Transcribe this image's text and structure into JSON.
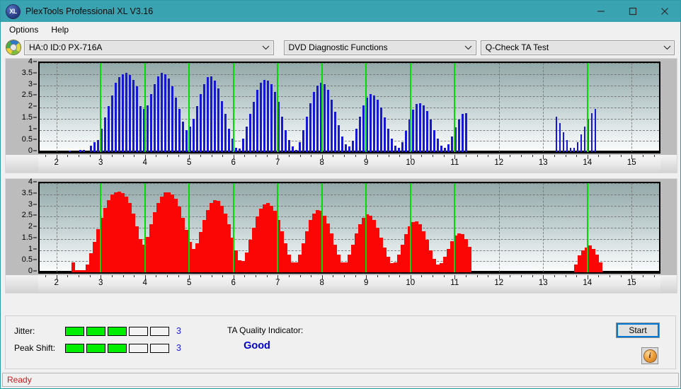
{
  "window": {
    "title": "PlexTools Professional XL V3.16",
    "icon": "xl-disc-icon",
    "minimize_label": "minimize-icon",
    "maximize_label": "maximize-icon",
    "close_label": "close-icon",
    "titlebar_color": "#3aa3b2"
  },
  "menu": {
    "items": [
      {
        "label": "Options"
      },
      {
        "label": "Help"
      }
    ]
  },
  "toolbar": {
    "drive_icon": "optical-disc-icon",
    "drive": {
      "value": "HA:0 ID:0  PX-716A",
      "arrow": "∨"
    },
    "function": {
      "value": "DVD Diagnostic Functions",
      "arrow": "∨"
    },
    "test": {
      "value": "Q-Check TA Test",
      "arrow": "∨"
    }
  },
  "chart_data": [
    {
      "id": "jitter-chart",
      "type": "bar",
      "title": "",
      "color": "#1717d6",
      "xlabel": "",
      "ylabel": "",
      "xlim": [
        1.62,
        15.62
      ],
      "ylim": [
        0,
        4
      ],
      "grid": true,
      "legend": "none",
      "yticks": [
        0,
        0.5,
        1,
        1.5,
        2,
        2.5,
        3,
        3.5,
        4
      ],
      "ytick_labels": [
        "0",
        "0.5",
        "1",
        "1.5",
        "2",
        "2.5",
        "3",
        "3.5",
        "4"
      ],
      "xticks": [
        2,
        3,
        4,
        5,
        6,
        7,
        8,
        9,
        10,
        11,
        12,
        13,
        14,
        15
      ],
      "xtick_labels": [
        "2",
        "3",
        "4",
        "5",
        "6",
        "7",
        "8",
        "9",
        "10",
        "11",
        "12",
        "13",
        "14",
        "15"
      ],
      "markers_x": [
        3,
        4,
        5,
        6,
        7,
        8,
        9,
        10,
        11,
        14
      ],
      "marker_color": "#00dd00",
      "bar_width": 0.042,
      "x": [
        2.3,
        2.38,
        2.46,
        2.54,
        2.62,
        2.7,
        2.78,
        2.86,
        2.94,
        3.02,
        3.1,
        3.18,
        3.26,
        3.34,
        3.42,
        3.5,
        3.58,
        3.66,
        3.74,
        3.82,
        3.9,
        3.98,
        4.06,
        4.14,
        4.22,
        4.3,
        4.38,
        4.46,
        4.54,
        4.62,
        4.7,
        4.78,
        4.86,
        4.94,
        5.02,
        5.1,
        5.18,
        5.26,
        5.34,
        5.42,
        5.5,
        5.58,
        5.66,
        5.74,
        5.82,
        5.9,
        5.98,
        6.06,
        6.14,
        6.22,
        6.3,
        6.38,
        6.46,
        6.54,
        6.62,
        6.7,
        6.78,
        6.86,
        6.94,
        7.02,
        7.1,
        7.18,
        7.26,
        7.34,
        7.42,
        7.5,
        7.58,
        7.66,
        7.74,
        7.82,
        7.9,
        7.98,
        8.06,
        8.14,
        8.22,
        8.3,
        8.38,
        8.46,
        8.54,
        8.62,
        8.7,
        8.78,
        8.86,
        8.94,
        9.02,
        9.1,
        9.18,
        9.26,
        9.34,
        9.42,
        9.5,
        9.58,
        9.66,
        9.74,
        9.82,
        9.9,
        9.98,
        10.06,
        10.14,
        10.22,
        10.3,
        10.38,
        10.46,
        10.54,
        10.62,
        10.7,
        10.78,
        10.86,
        10.94,
        11.02,
        11.1,
        11.18,
        11.26,
        13.3,
        13.38,
        13.46,
        13.54,
        13.62,
        13.7,
        13.78,
        13.86,
        13.94,
        14.02,
        14.1,
        14.18
      ],
      "values": [
        0.06,
        0,
        0,
        0.1,
        0.1,
        0,
        0.3,
        0.45,
        0.55,
        1.05,
        1.55,
        2.05,
        2.55,
        3.1,
        3.35,
        3.5,
        3.55,
        3.45,
        3.25,
        2.95,
        2.05,
        1.95,
        2.1,
        2.6,
        3.05,
        3.4,
        3.55,
        3.5,
        3.3,
        2.95,
        2.45,
        1.95,
        1.35,
        1.0,
        1.15,
        1.5,
        2.05,
        2.6,
        3.05,
        3.35,
        3.4,
        3.2,
        2.85,
        2.3,
        1.7,
        1.05,
        0.6,
        0.2,
        0.15,
        0.6,
        1.15,
        1.7,
        2.25,
        2.8,
        3.1,
        3.25,
        3.2,
        3.05,
        2.7,
        2.25,
        1.6,
        1.0,
        0.55,
        0.25,
        0.1,
        0.45,
        1.0,
        1.6,
        2.2,
        2.7,
        3.0,
        3.1,
        3.05,
        2.8,
        2.35,
        1.8,
        1.2,
        0.7,
        0.35,
        0.25,
        0.5,
        1.05,
        1.6,
        2.1,
        2.45,
        2.6,
        2.55,
        2.35,
        2.0,
        1.55,
        1.05,
        0.6,
        0.3,
        0.2,
        0.45,
        0.95,
        1.45,
        1.9,
        2.15,
        2.2,
        2.1,
        1.85,
        1.45,
        1.0,
        0.6,
        0.3,
        0.2,
        0.35,
        0.7,
        1.1,
        1.45,
        1.7,
        1.75,
        1.6,
        1.3,
        0.9,
        0.55,
        0.2,
        0.2,
        0.45,
        0.8,
        1.15,
        1.5,
        1.75,
        1.95,
        2.1,
        2.15,
        1.85,
        1.25,
        0.6
      ]
    },
    {
      "id": "peak-shift-chart",
      "type": "bar",
      "title": "",
      "color": "#fb0505",
      "xlabel": "",
      "ylabel": "",
      "xlim": [
        1.62,
        15.62
      ],
      "ylim": [
        0,
        4
      ],
      "grid": true,
      "legend": "none",
      "yticks": [
        0,
        0.5,
        1,
        1.5,
        2,
        2.5,
        3,
        3.5,
        4
      ],
      "ytick_labels": [
        "0",
        "0.5",
        "1",
        "1.5",
        "2",
        "2.5",
        "3",
        "3.5",
        "4"
      ],
      "xticks": [
        2,
        3,
        4,
        5,
        6,
        7,
        8,
        9,
        10,
        11,
        12,
        13,
        14,
        15
      ],
      "xtick_labels": [
        "2",
        "3",
        "4",
        "5",
        "6",
        "7",
        "8",
        "9",
        "10",
        "11",
        "12",
        "13",
        "14",
        "15"
      ],
      "markers_x": [
        3,
        4,
        5,
        6,
        7,
        8,
        9,
        10,
        11,
        14
      ],
      "marker_color": "#00dd00",
      "bar_width": 0.068,
      "x": [
        2.38,
        2.46,
        2.54,
        2.62,
        2.7,
        2.78,
        2.86,
        2.94,
        3.02,
        3.1,
        3.18,
        3.26,
        3.34,
        3.42,
        3.5,
        3.58,
        3.66,
        3.74,
        3.82,
        3.9,
        3.98,
        4.06,
        4.14,
        4.22,
        4.3,
        4.38,
        4.46,
        4.54,
        4.62,
        4.7,
        4.78,
        4.86,
        4.94,
        5.02,
        5.1,
        5.18,
        5.26,
        5.34,
        5.42,
        5.5,
        5.58,
        5.66,
        5.74,
        5.82,
        5.9,
        5.98,
        6.06,
        6.14,
        6.22,
        6.3,
        6.38,
        6.46,
        6.54,
        6.62,
        6.7,
        6.78,
        6.86,
        6.94,
        7.02,
        7.1,
        7.18,
        7.26,
        7.34,
        7.42,
        7.5,
        7.58,
        7.66,
        7.74,
        7.82,
        7.9,
        7.98,
        8.06,
        8.14,
        8.22,
        8.3,
        8.38,
        8.46,
        8.54,
        8.62,
        8.7,
        8.78,
        8.86,
        8.94,
        9.02,
        9.1,
        9.18,
        9.26,
        9.34,
        9.42,
        9.5,
        9.58,
        9.66,
        9.74,
        9.82,
        9.9,
        9.98,
        10.06,
        10.14,
        10.22,
        10.3,
        10.38,
        10.46,
        10.54,
        10.62,
        10.7,
        10.78,
        10.86,
        10.94,
        11.02,
        11.1,
        11.18,
        11.26,
        11.34,
        13.74,
        13.82,
        13.9,
        13.98,
        14.06,
        14.14,
        14.22,
        14.3
      ],
      "values": [
        0.45,
        0.1,
        0.1,
        0.1,
        0.35,
        0.85,
        1.35,
        1.95,
        2.45,
        2.9,
        3.25,
        3.5,
        3.6,
        3.62,
        3.55,
        3.4,
        3.1,
        2.65,
        2.05,
        1.5,
        1.25,
        1.6,
        2.15,
        2.7,
        3.1,
        3.4,
        3.58,
        3.6,
        3.5,
        3.3,
        2.95,
        2.45,
        1.9,
        1.35,
        1.05,
        1.3,
        1.8,
        2.35,
        2.8,
        3.1,
        3.25,
        3.2,
        3.0,
        2.65,
        2.15,
        1.55,
        1.0,
        0.55,
        0.5,
        0.9,
        1.45,
        2.0,
        2.5,
        2.85,
        3.05,
        3.1,
        3.0,
        2.75,
        2.35,
        1.85,
        1.3,
        0.8,
        0.45,
        0.45,
        0.8,
        1.3,
        1.85,
        2.35,
        2.65,
        2.8,
        2.75,
        2.55,
        2.2,
        1.75,
        1.25,
        0.8,
        0.45,
        0.45,
        0.8,
        1.25,
        1.75,
        2.15,
        2.45,
        2.6,
        2.55,
        2.35,
        2.0,
        1.55,
        1.1,
        0.7,
        0.4,
        0.45,
        0.8,
        1.25,
        1.7,
        2.05,
        2.25,
        2.3,
        2.15,
        1.85,
        1.45,
        1.0,
        0.6,
        0.35,
        0.4,
        0.7,
        1.05,
        1.4,
        1.65,
        1.75,
        1.7,
        1.5,
        1.15,
        0.35,
        0.75,
        1.0,
        1.1,
        1.2,
        1.05,
        0.8,
        0.45
      ]
    }
  ],
  "indicators": {
    "jitter": {
      "label": "Jitter:",
      "segments_total": 5,
      "segments_on": 3,
      "value": "3",
      "on_color": "#00ef00"
    },
    "peak_shift": {
      "label": "Peak Shift:",
      "segments_total": 5,
      "segments_on": 3,
      "value": "3",
      "on_color": "#00ef00"
    },
    "ta_quality": {
      "label": "TA Quality Indicator:",
      "value": "Good",
      "value_color": "#0000cc"
    }
  },
  "actions": {
    "start": {
      "label": "Start"
    },
    "info": {
      "label": "i",
      "icon": "info-icon"
    }
  },
  "status": {
    "text": "Ready",
    "color": "#d11a1a"
  }
}
